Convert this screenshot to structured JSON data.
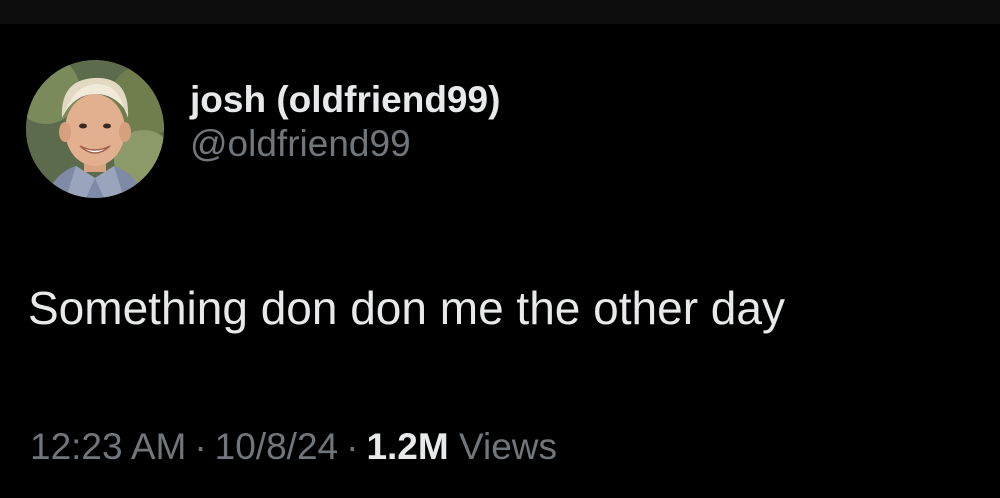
{
  "tweet": {
    "author": {
      "display_name": "josh (oldfriend99)",
      "handle": "@oldfriend99"
    },
    "text": "Something don don me the other day",
    "meta": {
      "time": "12:23 AM",
      "separator": "·",
      "date": "10/8/24",
      "views_count": "1.2M",
      "views_label": "Views"
    }
  },
  "colors": {
    "background": "#000000",
    "primary_text": "#e7e9ea",
    "secondary_text": "#71767b"
  }
}
